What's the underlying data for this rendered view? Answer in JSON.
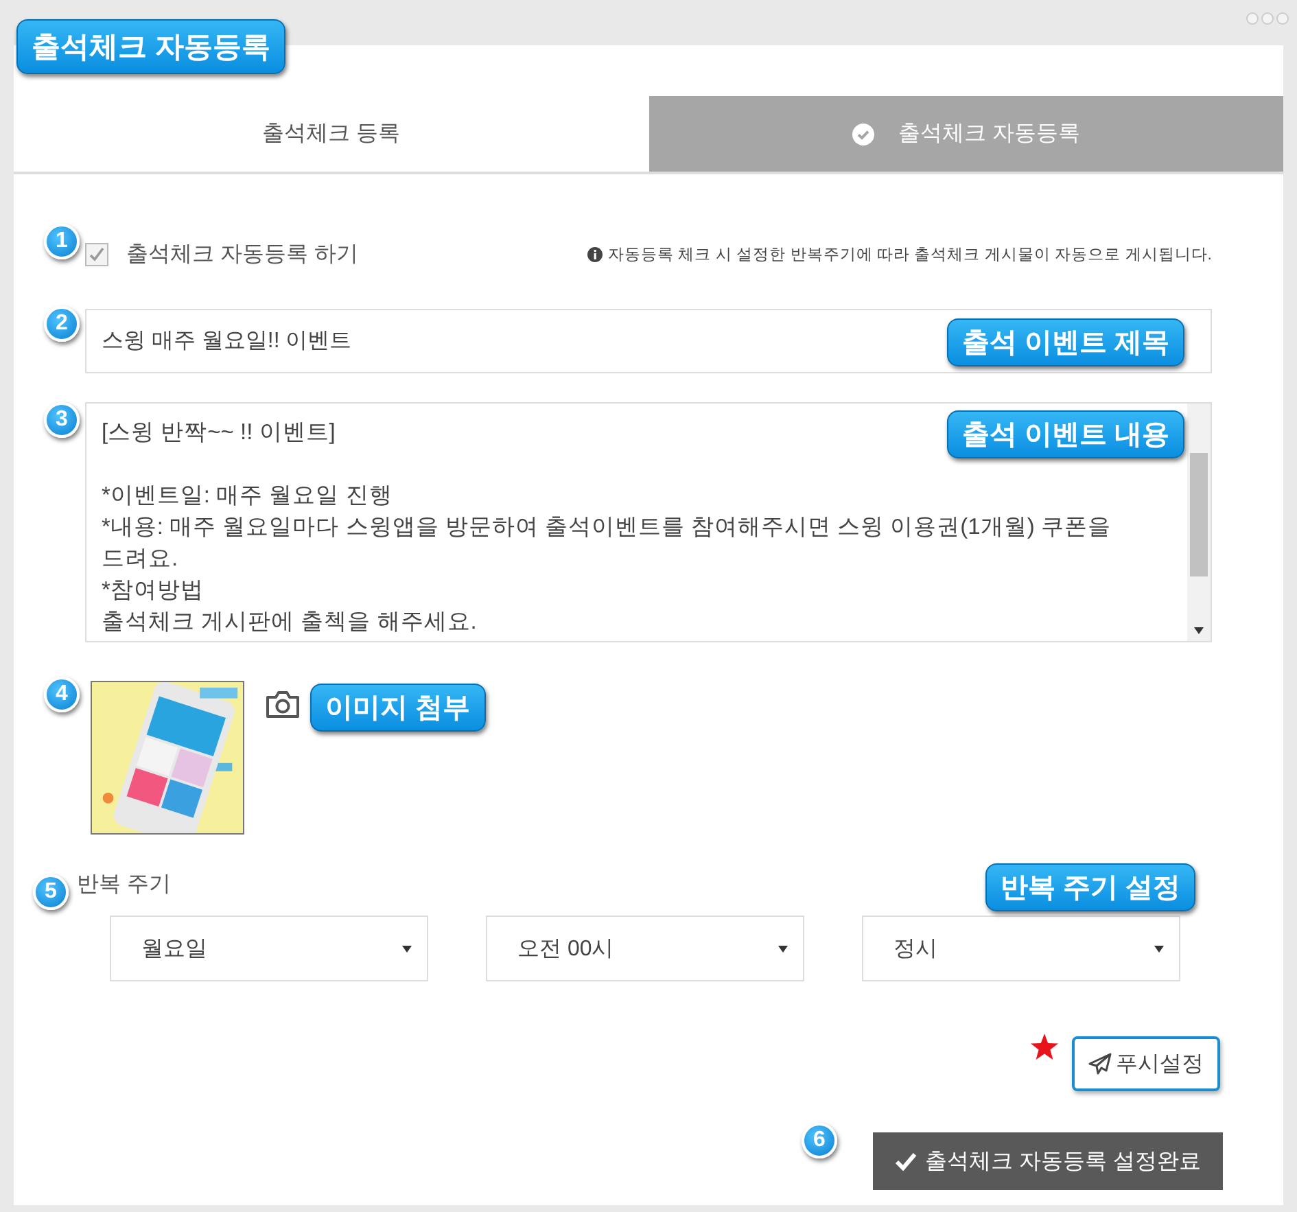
{
  "app_title": "출석체크 자동등록",
  "tabs": [
    {
      "label": "출석체크 등록",
      "selected": false
    },
    {
      "label": "출석체크 자동등록",
      "selected": true
    }
  ],
  "auto_register": {
    "label": "출석체크 자동등록 하기",
    "checked": true,
    "info": "자동등록 체크 시 설정한 반복주기에 따라 출석체크 게시물이 자동으로 게시됩니다."
  },
  "title_field": {
    "value": "스윙 매주 월요일!! 이벤트"
  },
  "content_field": {
    "paragraphs": [
      [
        "[스윙 반짝~~ !! 이벤트]"
      ],
      [
        "*이벤트일: 매주 월요일 진행",
        "*내용: 매주 월요일마다 스윙앱을 방문하여 출석이벤트를 참여해주시면 스윙 이용권(1개월) 쿠폰을 드려요.",
        "*참여방법",
        "출석체크 게시판에 출첵을 해주세요."
      ]
    ]
  },
  "repeat": {
    "label": "반복 주기",
    "selects": [
      "월요일",
      "오전 00시",
      "정시"
    ]
  },
  "push_button": "푸시설정",
  "submit_button": "출석체크 자동등록 설정완료",
  "step_markers": [
    "1",
    "2",
    "3",
    "4",
    "5",
    "6"
  ],
  "callout_labels": [
    "출석 이벤트 제목",
    "출석 이벤트 내용",
    "이미지 첨부",
    "반복 주기 설정"
  ]
}
